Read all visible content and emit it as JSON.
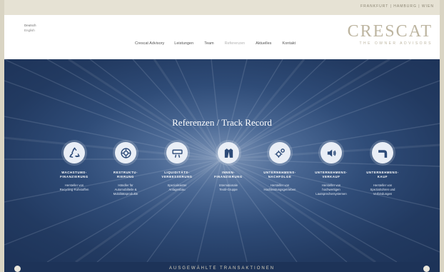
{
  "topbar": {
    "cities": "FRANKFURT | HAMBURG | WIEN"
  },
  "lang": {
    "current": "Deutsch",
    "other": "English"
  },
  "nav": [
    "Crescat Advisory",
    "Leistungen",
    "Team",
    "Referenzen",
    "Aktuelles",
    "Kontakt"
  ],
  "logo": {
    "word": "CRESCAT",
    "tagline": "THE OWNER ADVISORS"
  },
  "hero": {
    "title": "Referenzen / Track Record",
    "items": [
      {
        "category": "WACHSTUMS-\nFINANZIERUNG",
        "description": "Hersteller von\nRecycling-Rohstoffen",
        "icon": "recycle-icon"
      },
      {
        "category": "RESTRUKTU-\nRIERUNG",
        "description": "Händler für\nAutomobilteile &\nMobilitätsprodukte",
        "icon": "wheel-icon"
      },
      {
        "category": "LIQUIDITÄTS-\nVERBESSERUNG",
        "description": "Spezialisierter\nAnlagenbau",
        "icon": "air-conditioner-icon"
      },
      {
        "category": "INNEN-\nFINANZIERUNG",
        "description": "Internationale\nTextil-Gruppe",
        "icon": "jacket-icon"
      },
      {
        "category": "UNTERNEHMENS-\nNACHFOLGE",
        "description": "Hersteller von\nHochleistungsgetrieben",
        "icon": "gears-icon"
      },
      {
        "category": "UNTERNEHMENS-\nVERKAUF",
        "description": "Hersteller von\nhochwertigen\nLautsprechersystemen",
        "icon": "speaker-icon"
      },
      {
        "category": "UNTERNEHMENS-\nKAUF",
        "description": "Hersteller von\nSpezialrohren und\nVerbindungen",
        "icon": "pipe-icon"
      }
    ]
  },
  "bottom": {
    "label": "AUSGEWÄHLTE TRANSAKTIONEN"
  }
}
